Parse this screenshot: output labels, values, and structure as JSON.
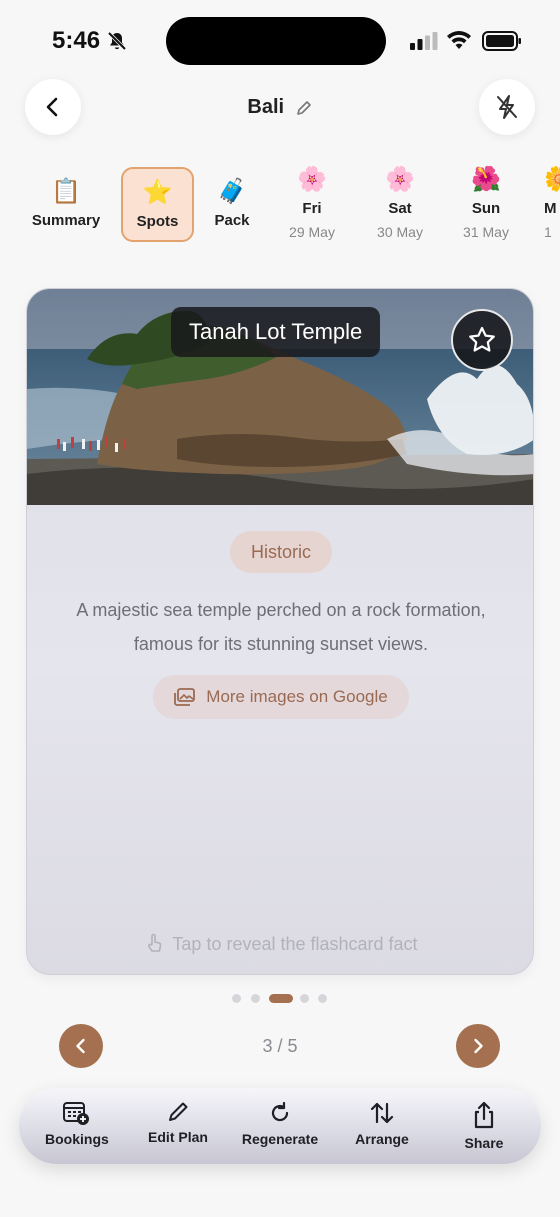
{
  "status_bar": {
    "time": "5:46"
  },
  "header": {
    "title": "Bali"
  },
  "tabs": [
    {
      "emoji": "📋",
      "label": "Summary",
      "sub": ""
    },
    {
      "emoji": "⭐",
      "label": "Spots",
      "sub": ""
    },
    {
      "emoji": "🧳",
      "label": "Pack",
      "sub": ""
    },
    {
      "emoji": "🌸",
      "label": "Fri",
      "sub": "29 May"
    },
    {
      "emoji": "🌸",
      "label": "Sat",
      "sub": "30 May"
    },
    {
      "emoji": "🌺",
      "label": "Sun",
      "sub": "31 May"
    },
    {
      "emoji": "🌼",
      "label": "M",
      "sub": "1"
    }
  ],
  "card": {
    "place": "Tanah Lot Temple",
    "category": "Historic",
    "description": "A majestic sea temple perched on a rock formation, famous for its stunning sunset views.",
    "google_button": "More images on Google",
    "hint": "Tap to reveal the flashcard fact"
  },
  "pager": {
    "indicator": "3 / 5",
    "current": 3,
    "total": 5
  },
  "bottom_bar": {
    "bookings": "Bookings",
    "edit_plan": "Edit Plan",
    "regenerate": "Regenerate",
    "arrange": "Arrange",
    "share": "Share"
  },
  "colors": {
    "accent": "#a5704f",
    "selected_tab_bg": "#fbe1d2",
    "selected_tab_border": "#e3a36f"
  }
}
